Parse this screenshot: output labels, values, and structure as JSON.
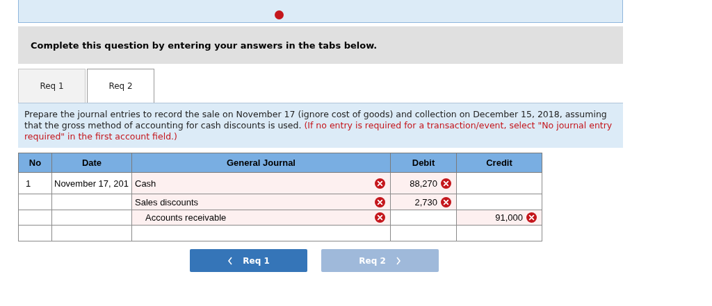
{
  "banner": {
    "error": true
  },
  "prompt": "Complete this question by entering your answers in the tabs below.",
  "tabs": [
    {
      "label": "Req 1",
      "selected": false
    },
    {
      "label": "Req 2",
      "selected": true
    }
  ],
  "instructions": {
    "text": "Prepare the journal entries to record the sale on November 17 (ignore cost of goods) and collection on December 15, 2018, assuming that the gross method of accounting for cash discounts is used.",
    "note": "(If no entry is required for a transaction/event, select \"No journal entry required\" in the first account field.)"
  },
  "table": {
    "columns": [
      "No",
      "Date",
      "General Journal",
      "Debit",
      "Credit"
    ],
    "rows": [
      {
        "no": "1",
        "date": "November 17, 201",
        "account": {
          "text": "Cash",
          "wrong": true,
          "indented": false
        },
        "debit": {
          "text": "88,270",
          "wrong": true
        }
      },
      {
        "account": {
          "text": "Sales discounts",
          "wrong": true,
          "indented": false
        },
        "debit": {
          "text": "2,730",
          "wrong": true
        }
      },
      {
        "account": {
          "text": "Accounts receivable",
          "wrong": true,
          "indented": true
        },
        "credit": {
          "text": "91,000",
          "wrong": true
        }
      },
      {}
    ]
  },
  "nav": [
    {
      "label": "Req 1",
      "kind": "prev",
      "disabled": false
    },
    {
      "label": "Req 2",
      "kind": "next",
      "disabled": true
    }
  ]
}
